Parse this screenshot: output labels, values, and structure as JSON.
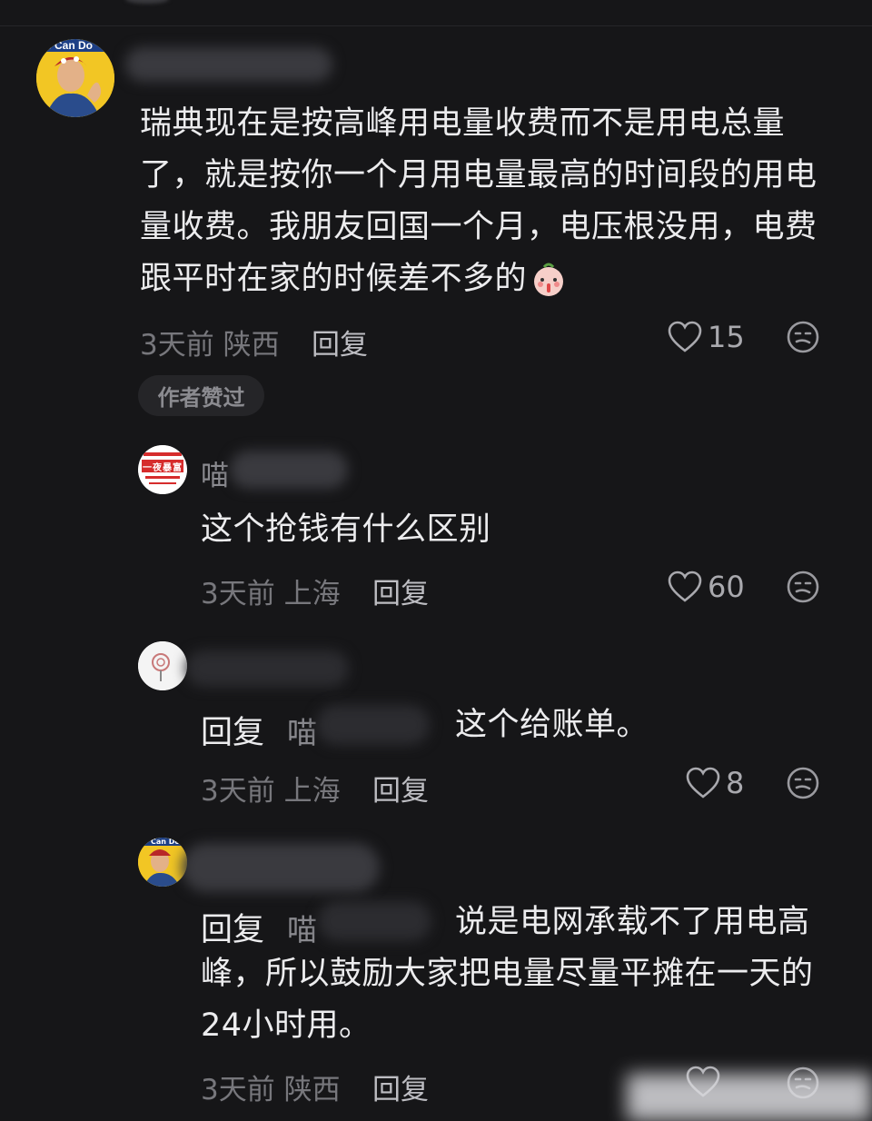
{
  "comments": [
    {
      "name_visible": "",
      "text": "瑞典现在是按高峰用电量收费而不是用电总量了，就是按你一个月用电量最高的时间段的用电量收费。我朋友回国一个月，电压根没用，电费跟平时在家的时候差不多的",
      "time": "3天前",
      "location": "陕西",
      "reply_label": "回复",
      "likes": "15",
      "badge": "作者赞过",
      "avatar_text": "e Can Do"
    },
    {
      "name_visible": "喵",
      "text": "这个抢钱有什么区别",
      "time": "3天前",
      "location": "上海",
      "reply_label": "回复",
      "likes": "60",
      "avatar_text": "一夜暴富"
    },
    {
      "name_visible": "",
      "reply_prefix": "回复",
      "reply_to": "喵",
      "text": "这个给账单。",
      "time": "3天前",
      "location": "上海",
      "reply_label": "回复",
      "likes": "8"
    },
    {
      "name_visible": "",
      "reply_prefix": "回复",
      "reply_to": "喵",
      "text": "说是电网承载不了用电高峰，所以鼓励大家把电量尽量平摊在一天的24小时用。",
      "time": "3天前",
      "location": "陕西",
      "reply_label": "回复",
      "likes": "",
      "avatar_text": "Can Do"
    }
  ],
  "icons": {
    "like": "heart-icon",
    "reaction": "emoji-face-icon",
    "inline_emoji": "shush-emoji-icon"
  },
  "colors": {
    "background": "#161618",
    "text": "#ececee",
    "meta": "#77777c",
    "avatar_yellow": "#f2c624",
    "avatar_red": "#d62c2c"
  }
}
